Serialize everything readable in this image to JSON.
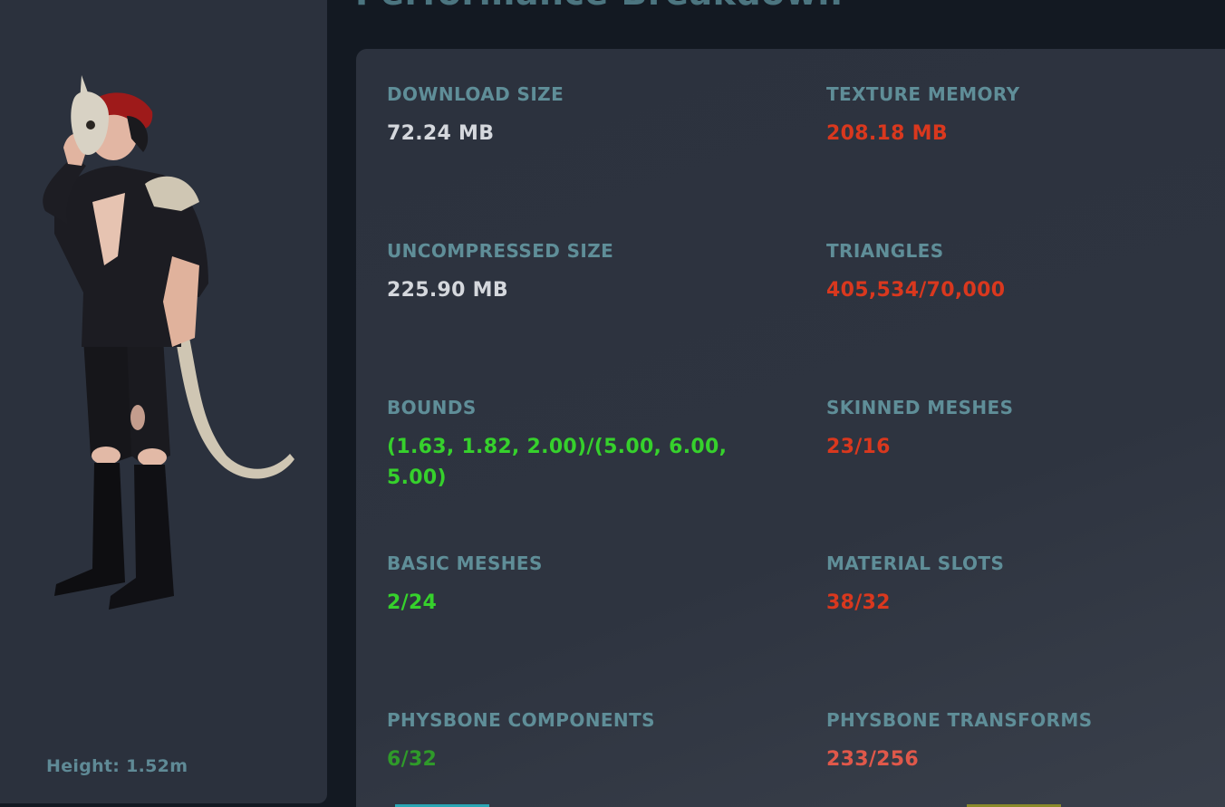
{
  "header": {
    "title": "Performance Breakdown"
  },
  "avatar": {
    "height_text": "Height: 1.52m"
  },
  "colors": {
    "label": "#5f8e98",
    "neutral": "#d5d8dd",
    "bad": "#d9381e",
    "good": "#36d12c",
    "ok": "#2f9a2a",
    "warn": "#e0584a"
  },
  "stats": [
    {
      "label": "DOWNLOAD SIZE",
      "value": "72.24 MB",
      "status": "neutral"
    },
    {
      "label": "TEXTURE MEMORY",
      "value": "208.18 MB",
      "status": "bad"
    },
    {
      "label": "UNCOMPRESSED SIZE",
      "value": "225.90 MB",
      "status": "neutral"
    },
    {
      "label": "TRIANGLES",
      "value": "405,534/70,000",
      "status": "bad"
    },
    {
      "label": "BOUNDS",
      "value": "(1.63, 1.82, 2.00)/(5.00, 6.00, 5.00)",
      "status": "good"
    },
    {
      "label": "SKINNED MESHES",
      "value": "23/16",
      "status": "bad"
    },
    {
      "label": "BASIC MESHES",
      "value": "2/24",
      "status": "good"
    },
    {
      "label": "MATERIAL SLOTS",
      "value": "38/32",
      "status": "bad"
    },
    {
      "label": "PHYSBONE COMPONENTS",
      "value": "6/32",
      "status": "ok"
    },
    {
      "label": "PHYSBONE TRANSFORMS",
      "value": "233/256",
      "status": "warn"
    }
  ]
}
